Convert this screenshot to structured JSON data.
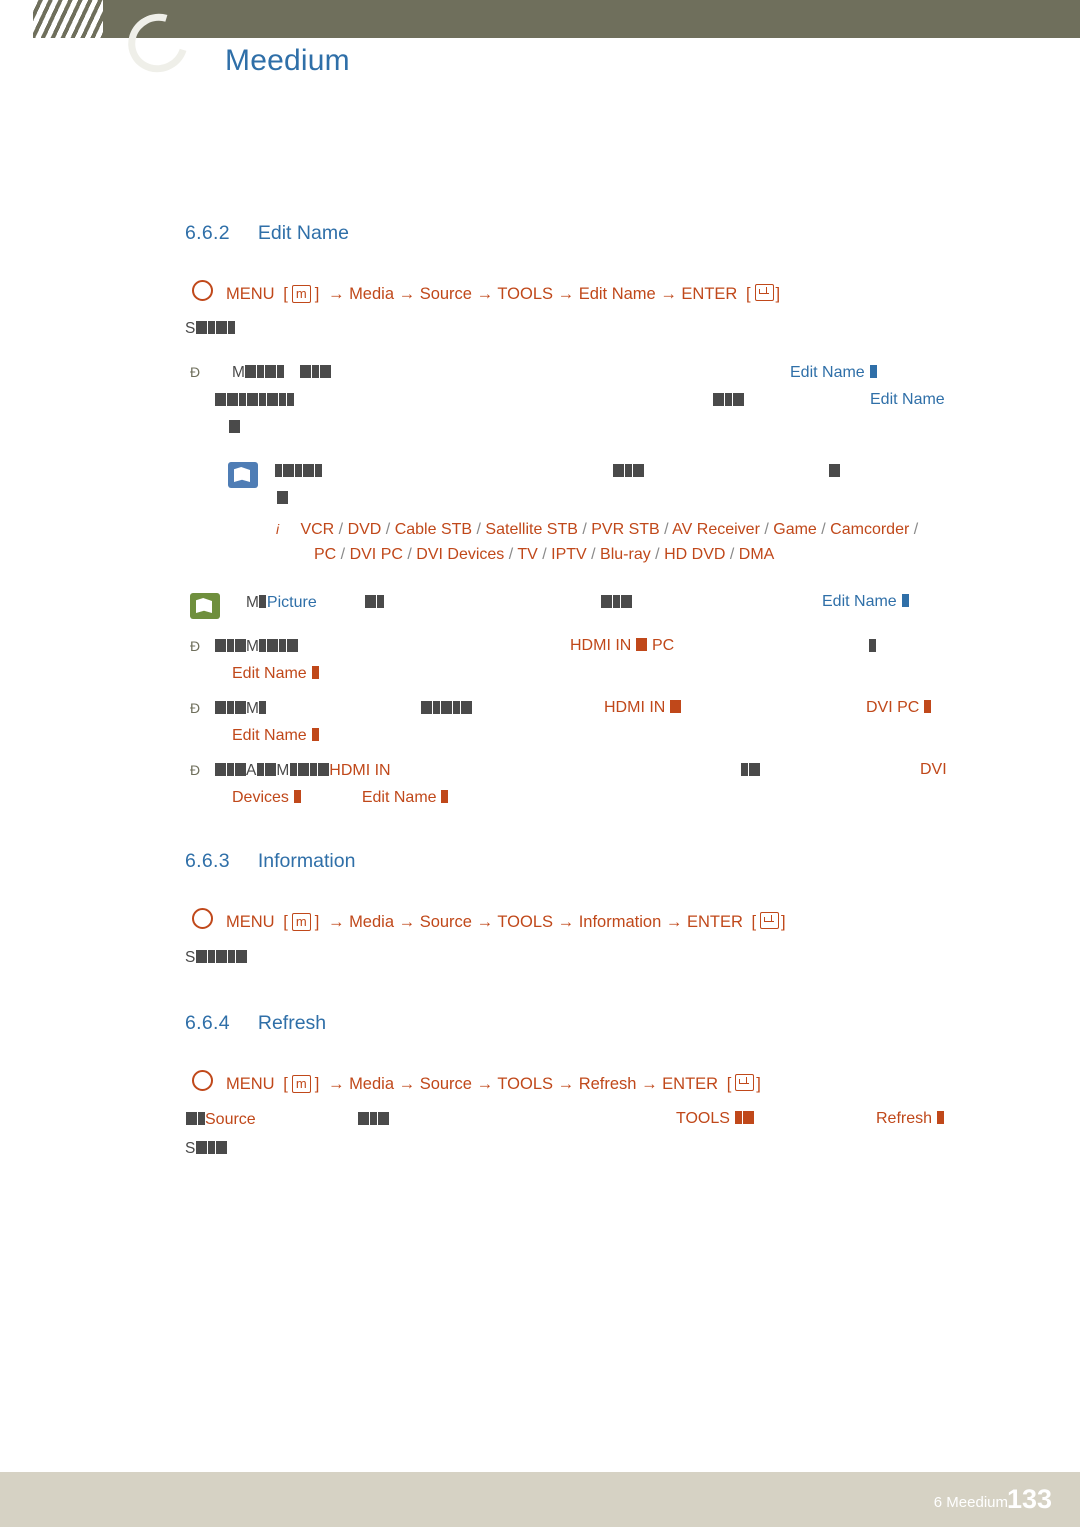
{
  "header": {
    "brand": "Meedium",
    "logo_name": "samsung-swoosh-logo"
  },
  "sections": [
    {
      "number": "6.6.2",
      "title": "Edit Name",
      "path": {
        "menu": "MENU",
        "key": "m",
        "steps": [
          "Media",
          "Source",
          "TOOLS",
          "Edit Name"
        ],
        "enter": "ENTER"
      }
    },
    {
      "number": "6.6.3",
      "title": "Information",
      "path": {
        "menu": "MENU",
        "key": "m",
        "steps": [
          "Media",
          "Source",
          "TOOLS",
          "Information"
        ],
        "enter": "ENTER"
      }
    },
    {
      "number": "6.6.4",
      "title": "Refresh",
      "path": {
        "menu": "MENU",
        "key": "m",
        "steps": [
          "Media",
          "Source",
          "TOOLS",
          "Refresh"
        ],
        "enter": "ENTER"
      }
    }
  ],
  "body": {
    "edit_name_label_1": "Edit Name",
    "edit_name_label_2": "Edit Name",
    "edit_name_label_3": "Edit Name",
    "edit_name_label_4": "Edit Name",
    "edit_name_label_5": "Edit Name",
    "edit_name_label_6": "Edit Name",
    "picture_label": "Picture",
    "hdmi_in_pc": "HDMI IN",
    "pc_label": "PC",
    "hdmi_in_2": "HDMI IN",
    "dvi_pc_label": "DVI PC",
    "hdmi_in_3": "HDMI IN",
    "dvi_label": "DVI",
    "devices_label": "Devices",
    "source_label": "Source",
    "tools_label": "TOOLS",
    "refresh_label": "Refresh",
    "device_list": [
      "VCR",
      "DVD",
      "Cable STB",
      "Satellite STB",
      "PVR STB",
      "AV Receiver",
      "Game",
      "Camcorder",
      "PC",
      "DVI PC",
      "DVI Devices",
      "TV",
      "IPTV",
      "Blu-ray",
      "HD DVD",
      "DMA"
    ]
  },
  "footer": {
    "chapter": "6 Meedium",
    "page": "133"
  }
}
